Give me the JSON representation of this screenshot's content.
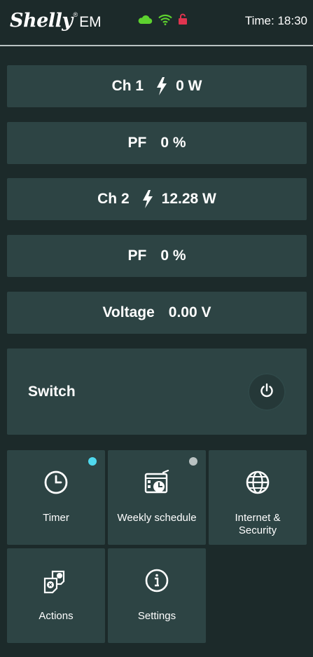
{
  "header": {
    "brand": "Shelly",
    "brand_reg": "®",
    "model": "EM",
    "time_text": "Time: 18:30",
    "icons": [
      "cloud-icon",
      "wifi-icon",
      "lock-open-icon"
    ],
    "colors": {
      "cloud": "#5dd12f",
      "wifi": "#5dd12f",
      "lock": "#e0344f"
    }
  },
  "readings": {
    "ch1": {
      "label": "Ch 1",
      "value": "0 W",
      "icon": "lightning-icon"
    },
    "pf1": {
      "label": "PF",
      "value": "0 %"
    },
    "ch2": {
      "label": "Ch 2",
      "value": "12.28 W",
      "icon": "lightning-icon"
    },
    "pf2": {
      "label": "PF",
      "value": "0 %"
    },
    "voltage": {
      "label": "Voltage",
      "value": "0.00 V"
    }
  },
  "switch": {
    "label": "Switch",
    "icon": "power-icon"
  },
  "tiles": {
    "timer": {
      "label": "Timer",
      "icon": "clock-icon",
      "indicator_color": "#4fd9ee"
    },
    "weekly": {
      "label": "Weekly schedule",
      "icon": "calendar-schedule-icon",
      "indicator_color": "#b9c2c2"
    },
    "internet": {
      "label_line1": "Internet &",
      "label_line2": "Security",
      "icon": "globe-icon"
    },
    "actions": {
      "label": "Actions",
      "icon": "actions-icon"
    },
    "settings": {
      "label": "Settings",
      "icon": "info-icon"
    }
  },
  "colors": {
    "background": "#1c2a2a",
    "panel": "#2d4444",
    "text": "#ffffff"
  }
}
